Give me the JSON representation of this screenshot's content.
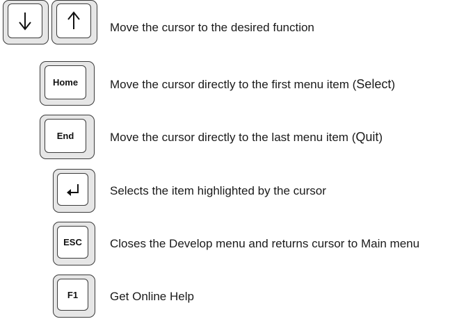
{
  "rows": [
    {
      "keys": [
        {
          "label": "",
          "icon": "arrow-down-icon"
        },
        {
          "label": "",
          "icon": "arrow-up-icon"
        }
      ],
      "description": "Move the cursor to the desired function"
    },
    {
      "keys": [
        {
          "label": "Home"
        }
      ],
      "description_before": "Move the cursor directly to the first menu item (",
      "description_highlight": "Select",
      "description_after": ")"
    },
    {
      "keys": [
        {
          "label": "End"
        }
      ],
      "description_before": "Move the cursor directly to the last menu item (",
      "description_highlight": "Quit",
      "description_after": ")"
    },
    {
      "keys": [
        {
          "label": "",
          "icon": "enter-icon"
        }
      ],
      "description": "Selects the item highlighted by the cursor"
    },
    {
      "keys": [
        {
          "label": "ESC"
        }
      ],
      "description": "Closes the Develop menu and returns cursor to Main menu"
    },
    {
      "keys": [
        {
          "label": "F1"
        }
      ],
      "description": "Get Online Help"
    }
  ]
}
